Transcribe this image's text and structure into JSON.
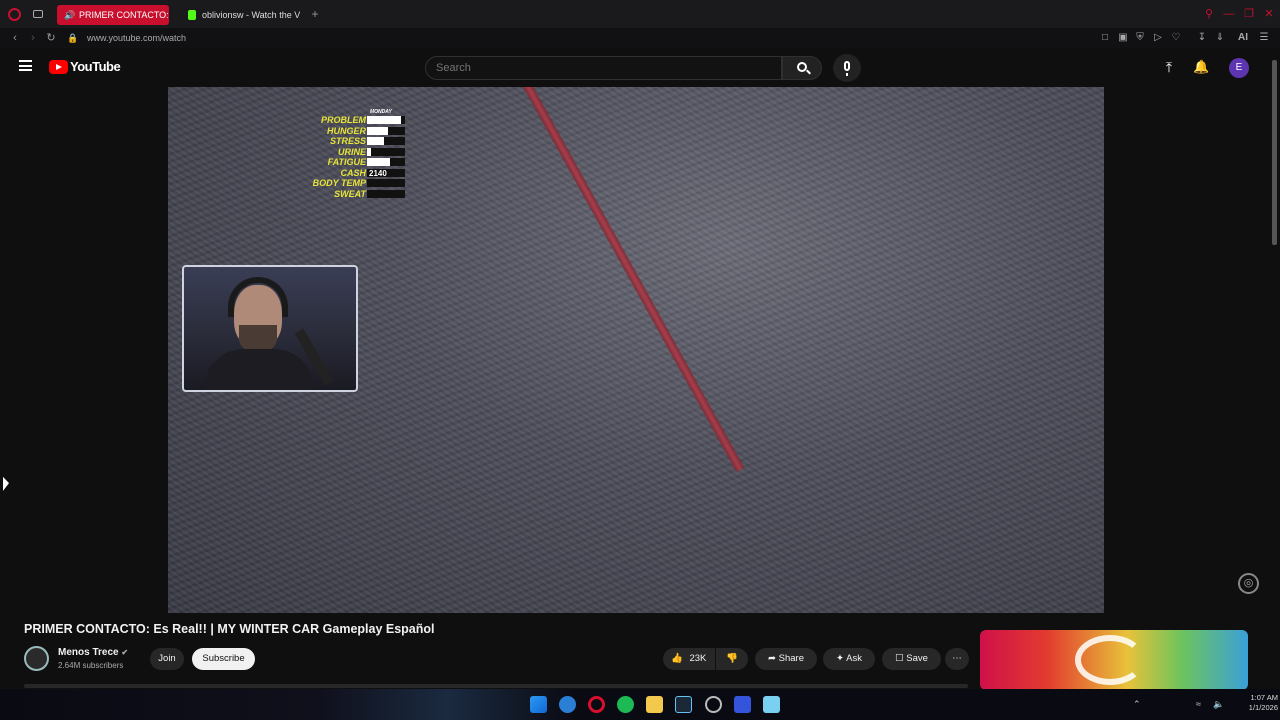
{
  "browser": {
    "tabs": [
      {
        "label": "PRIMER CONTACTO: E",
        "active": true
      },
      {
        "label": "oblivionsw - Watch the VO",
        "active": false
      }
    ],
    "new_tab": "+",
    "url": "www.youtube.com/watch",
    "ai_label": "AI"
  },
  "youtube": {
    "logo_text": "YouTube",
    "search_placeholder": "Search",
    "avatar_letter": "E"
  },
  "video": {
    "hud": {
      "day": "MONDAY",
      "rows": [
        {
          "label": "PROBLEM",
          "fill": 0.9
        },
        {
          "label": "HUNGER",
          "fill": 0.55
        },
        {
          "label": "STRESS",
          "fill": 0.45
        },
        {
          "label": "URINE",
          "fill": 0.1
        },
        {
          "label": "FATIGUE",
          "fill": 0.6
        },
        {
          "label": "CASH",
          "value": "2140"
        },
        {
          "label": "BODY TEMP",
          "fill": 0
        },
        {
          "label": "SWEAT",
          "fill": 0
        }
      ]
    }
  },
  "watch": {
    "title": "PRIMER CONTACTO: Es Real!! | MY WINTER CAR Gameplay Español",
    "channel_name": "Menos Trece",
    "subscribers": "2.64M subscribers",
    "join_label": "Join",
    "subscribe_label": "Subscribe",
    "likes": "23K",
    "share_label": "Share",
    "ask_label": "Ask",
    "save_label": "Save"
  },
  "taskbar": {
    "time": "1:07 AM",
    "date": "1/1/2026"
  },
  "colors": {
    "accent_red": "#c8102e",
    "hud_yellow": "#e8e43a",
    "yt_red": "#ff0000"
  }
}
